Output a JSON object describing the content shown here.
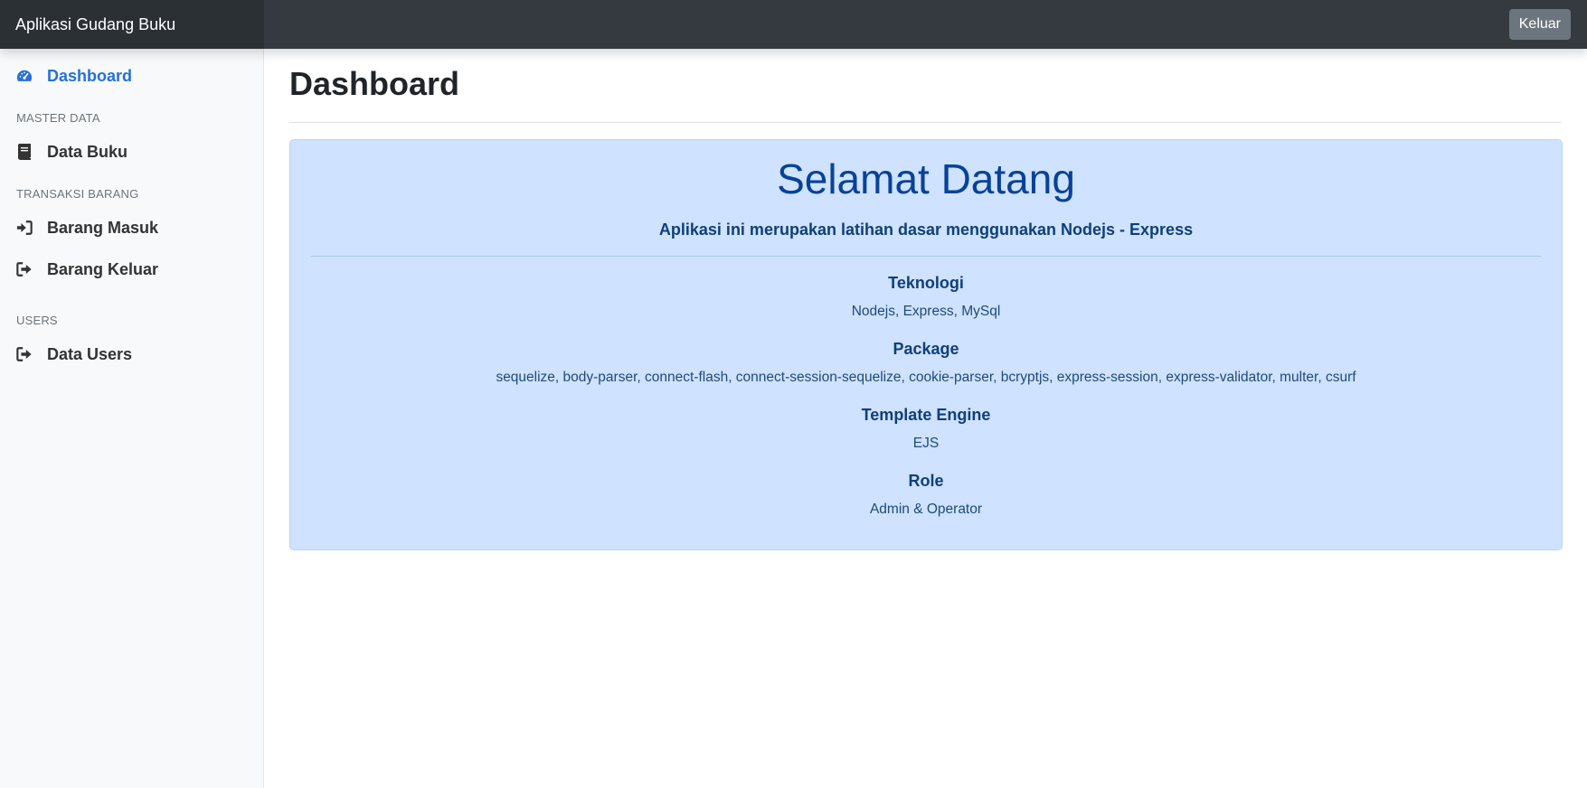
{
  "navbar": {
    "brand": "Aplikasi Gudang Buku",
    "logout_label": "Keluar"
  },
  "sidebar": {
    "dashboard": {
      "label": "Dashboard",
      "icon": "tachometer-icon"
    },
    "sections": [
      {
        "heading": "MASTER DATA",
        "items": [
          {
            "label": "Data Buku",
            "icon": "book-icon"
          }
        ]
      },
      {
        "heading": "TRANSAKSI BARANG",
        "items": [
          {
            "label": "Barang Masuk",
            "icon": "sign-in-icon"
          },
          {
            "label": "Barang Keluar",
            "icon": "sign-out-icon"
          }
        ]
      },
      {
        "heading": "USERS",
        "items": [
          {
            "label": "Data Users",
            "icon": "sign-out-icon"
          }
        ]
      }
    ],
    "active_color": "#2470dc"
  },
  "main": {
    "title": "Dashboard",
    "welcome": {
      "heading": "Selamat Datang",
      "lead": "Aplikasi ini merupakan latihan dasar menggunakan Nodejs - Express",
      "sections": [
        {
          "title": "Teknologi",
          "value": "Nodejs, Express, MySql"
        },
        {
          "title": "Package",
          "value": "sequelize, body-parser, connect-flash, connect-session-sequelize, cookie-parser, bcryptjs, express-session, express-validator, multer, csurf"
        },
        {
          "title": "Template Engine",
          "value": "EJS"
        },
        {
          "title": "Role",
          "value": "Admin & Operator"
        }
      ]
    }
  },
  "colors": {
    "navbar": "#343a40",
    "brand_bg": "#2b3035",
    "sidebar_bg": "#f8f9fa",
    "alert_bg": "#cfe2ff",
    "alert_text": "#084298",
    "button_secondary": "#6c757d"
  }
}
